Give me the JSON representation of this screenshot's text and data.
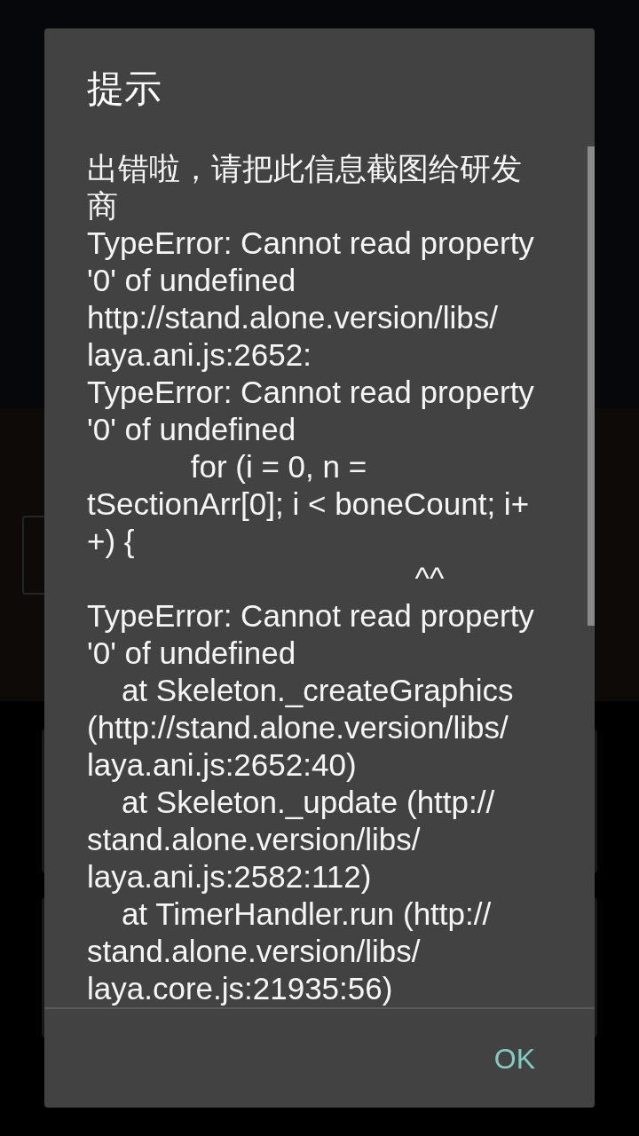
{
  "dialog": {
    "title": "提示",
    "message_lines": [
      "出错啦，请把此信息截图给研发",
      "商",
      "TypeError: Cannot read property",
      "'0' of undefined",
      "http://stand.alone.version/libs/",
      "laya.ani.js:2652:",
      "TypeError: Cannot read property",
      "'0' of undefined",
      "            for (i = 0, n =",
      "tSectionArr[0]; i < boneCount; i+",
      "+) {",
      "                                      ^^",
      "TypeError: Cannot read property",
      "'0' of undefined",
      "    at Skeleton._createGraphics",
      "(http://stand.alone.version/libs/",
      "laya.ani.js:2652:40)",
      "    at Skeleton._update (http://",
      "stand.alone.version/libs/",
      "laya.ani.js:2582:112)",
      "    at TimerHandler.run (http://",
      "stand.alone.version/libs/",
      "laya.core.js:21935:56)"
    ],
    "buttons": [
      {
        "label": "OK"
      }
    ]
  }
}
